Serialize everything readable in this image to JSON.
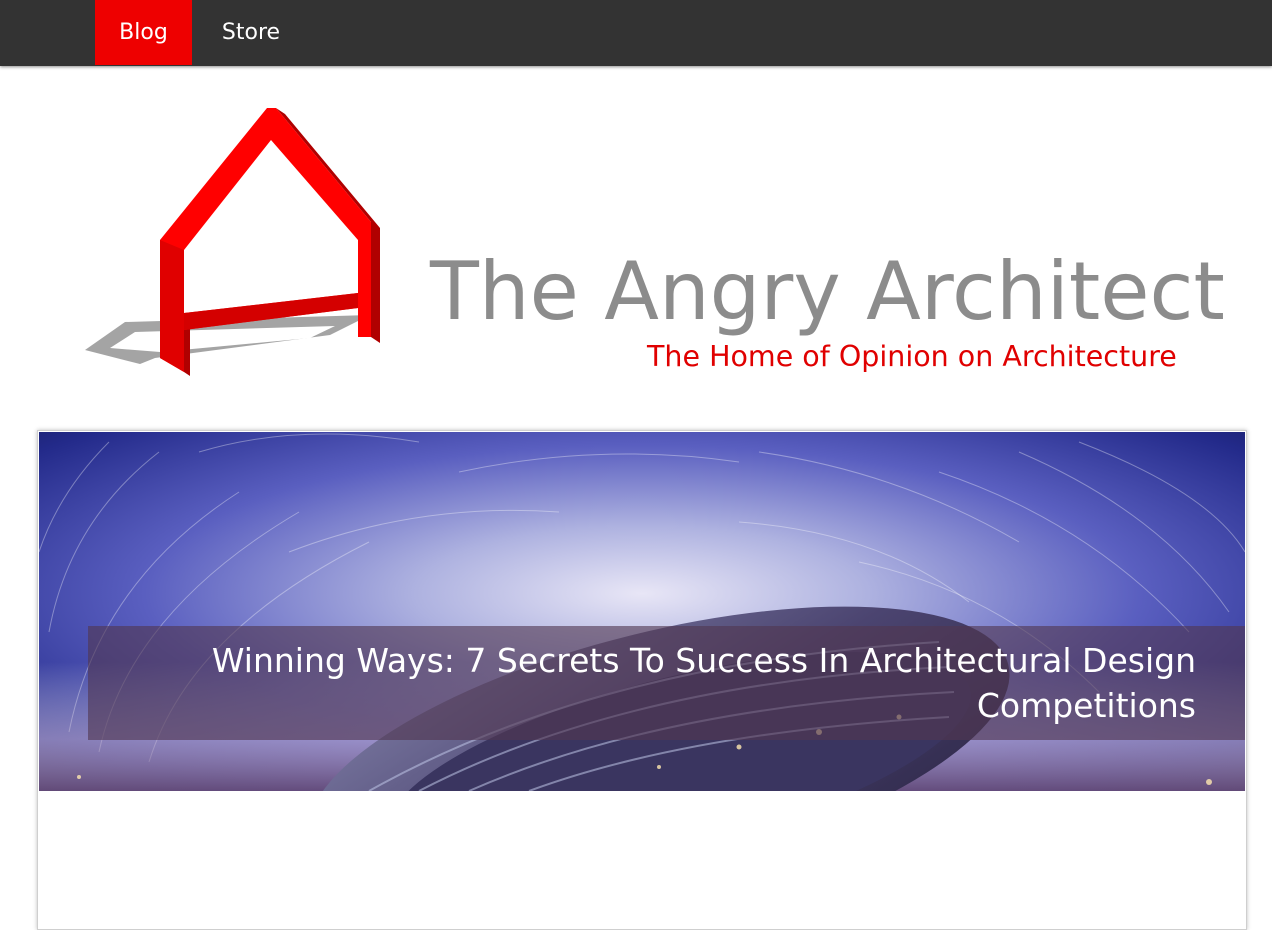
{
  "nav": {
    "items": [
      {
        "label": "Blog",
        "active": true
      },
      {
        "label": "Store",
        "active": false
      }
    ]
  },
  "header": {
    "title": "The Angry Architect",
    "tagline": "The Home of Opinion on Architecture",
    "logo_icon": "red-house-frame-icon"
  },
  "featured_post": {
    "title": "Winning Ways: 7 Secrets To Success In Architectural Design Competitions"
  },
  "colors": {
    "nav_background": "#333333",
    "nav_active": "#ee0000",
    "title_gray": "#8c8c8c",
    "tagline_red": "#e00000"
  }
}
